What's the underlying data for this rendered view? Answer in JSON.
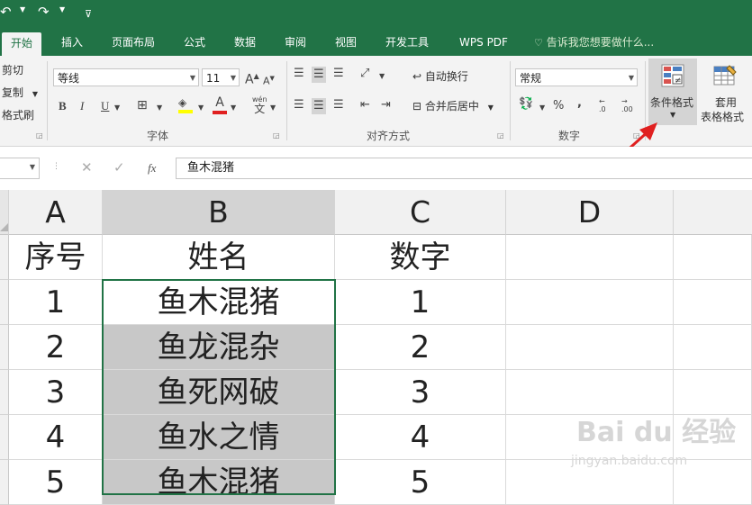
{
  "quick_access": {
    "undo_icon": "undo-icon",
    "redo_icon": "redo-icon",
    "customize_icon": "customize-qat-icon"
  },
  "tabs": [
    {
      "label": "开始",
      "active": true
    },
    {
      "label": "插入"
    },
    {
      "label": "页面布局"
    },
    {
      "label": "公式"
    },
    {
      "label": "数据"
    },
    {
      "label": "审阅"
    },
    {
      "label": "视图"
    },
    {
      "label": "开发工具"
    },
    {
      "label": "WPS PDF"
    }
  ],
  "tell_me": "告诉我您想要做什么...",
  "clipboard": {
    "cut": "剪切",
    "copy": "复制",
    "format_painter": "格式刷"
  },
  "font": {
    "name": "等线",
    "size": "11",
    "bold": "B",
    "italic": "I",
    "underline": "U",
    "grow": "A",
    "shrink": "A",
    "font_color_letter": "A",
    "phonetic": "wén",
    "phonetic_char": "文",
    "group_label": "字体"
  },
  "alignment": {
    "wrap_text": "自动换行",
    "merge_center": "合并后居中",
    "group_label": "对齐方式"
  },
  "number": {
    "format": "常规",
    "percent": "%",
    "comma": ",",
    "inc_decimal": ".0",
    "dec_decimal": ".00",
    "group_label": "数字"
  },
  "styles": {
    "conditional_formatting": "条件格式",
    "format_as_table_line1": "套用",
    "format_as_table_line2": "表格格式"
  },
  "formula_bar": {
    "fx": "fx",
    "content": "鱼木混猪"
  },
  "columns": [
    "A",
    "B",
    "C",
    "D"
  ],
  "rows": [
    [
      "序号",
      "姓名",
      "数字",
      ""
    ],
    [
      "1",
      "鱼木混猪",
      "1",
      ""
    ],
    [
      "2",
      "鱼龙混杂",
      "2",
      ""
    ],
    [
      "3",
      "鱼死网破",
      "3",
      ""
    ],
    [
      "4",
      "鱼水之情",
      "4",
      ""
    ],
    [
      "5",
      "鱼木混猪",
      "5",
      ""
    ]
  ],
  "watermark": {
    "text": "Bai du 经验",
    "url": "jingyan.baidu.com"
  },
  "colors": {
    "excel_green": "#217346",
    "ribbon_bg": "#f3f3f3",
    "cell_highlight": "#c8c8c8",
    "arrow": "#e02020"
  }
}
